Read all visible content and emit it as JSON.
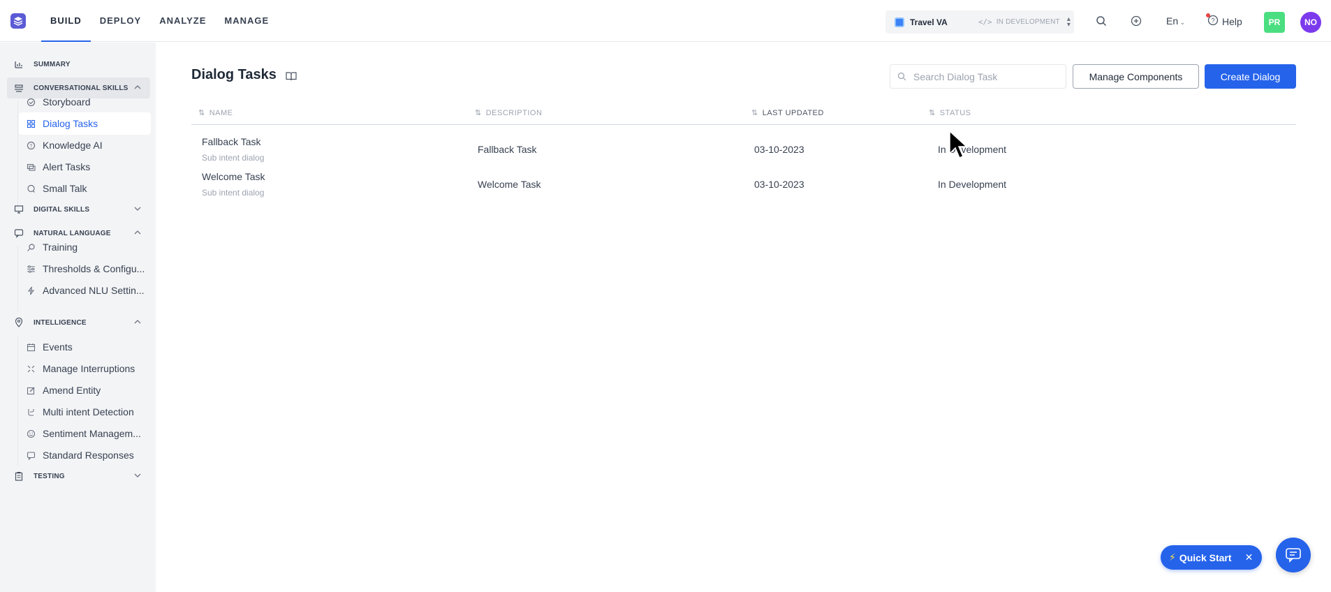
{
  "nav": {
    "items": [
      {
        "label": "BUILD",
        "active": true
      },
      {
        "label": "DEPLOY",
        "active": false
      },
      {
        "label": "ANALYZE",
        "active": false
      },
      {
        "label": "MANAGE",
        "active": false
      }
    ]
  },
  "bot": {
    "name": "Travel VA",
    "status": "IN DEVELOPMENT"
  },
  "header": {
    "language": "En",
    "help_label": "Help",
    "avatar_pr": "PR",
    "avatar_no": "NO"
  },
  "sidebar": {
    "summary": "SUMMARY",
    "conversational_skills": {
      "label": "CONVERSATIONAL SKILLS",
      "items": [
        "Storyboard",
        "Dialog Tasks",
        "Knowledge AI",
        "Alert Tasks",
        "Small Talk"
      ]
    },
    "digital_skills": "DIGITAL SKILLS",
    "natural_language": {
      "label": "NATURAL LANGUAGE",
      "items": [
        "Training",
        "Thresholds & Configu...",
        "Advanced NLU Settin..."
      ]
    },
    "intelligence": {
      "label": "INTELLIGENCE",
      "items": [
        "Events",
        "Manage Interruptions",
        "Amend Entity",
        "Multi intent Detection",
        "Sentiment Managem...",
        "Standard Responses"
      ]
    },
    "testing": "TESTING"
  },
  "main": {
    "title": "Dialog Tasks",
    "search_placeholder": "Search Dialog Task",
    "manage_components_label": "Manage Components",
    "create_dialog_label": "Create Dialog",
    "columns": {
      "name": "NAME",
      "description": "DESCRIPTION",
      "last_updated": "LAST UPDATED",
      "status": "STATUS"
    },
    "rows": [
      {
        "name": "Fallback Task",
        "type": "Sub intent dialog",
        "description": "Fallback Task",
        "last_updated": "03-10-2023",
        "status": "In Development"
      },
      {
        "name": "Welcome Task",
        "type": "Sub intent dialog",
        "description": "Welcome Task",
        "last_updated": "03-10-2023",
        "status": "In Development"
      }
    ]
  },
  "quick_start": {
    "label": "Quick Start"
  },
  "colors": {
    "accent": "#2563eb",
    "sidebar_bg": "#f3f4f6",
    "avatar_pr": "#4ade80",
    "avatar_no": "#7c3aed"
  }
}
